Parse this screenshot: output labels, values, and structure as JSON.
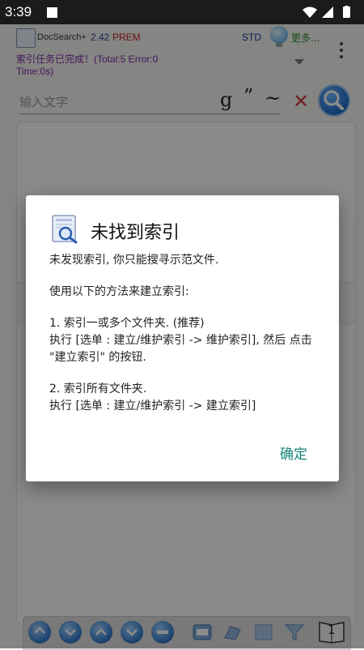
{
  "status_bar": {
    "time": "3:39"
  },
  "header": {
    "app_name": "DocSearch+",
    "version": "2.42",
    "edition": "PREM",
    "mode": "STD",
    "more": "更多..."
  },
  "index_status": {
    "line1": "索引任务已完成！(Total:5 Error:0",
    "line2": "Time:0s)"
  },
  "search": {
    "placeholder": "输入文字",
    "symbols": [
      "g",
      "”",
      "~"
    ]
  },
  "dialog": {
    "title": "未找到索引",
    "paragraphs": [
      "未发现索引, 你只能搜寻示范文件.",
      "使用以下的方法来建立索引:",
      "1. 索引一或多个文件夹. (推荐)",
      "执行 [选单 : 建立/维护索引 -> 维护索引], 然后 点击 \"建立索引\" 的按钮.",
      "2. 索引所有文件夹.",
      "执行 [选单 : 建立/维护索引 -> 建立索引]"
    ],
    "ok_label": "确定"
  },
  "bottom_bar": {
    "page_number": "1"
  },
  "colors": {
    "accent_teal": "#14857b",
    "status_purple": "#7a2aa8",
    "prem_red": "#c42020",
    "version_blue": "#2a3aa8"
  },
  "icons": {
    "wifi": "wifi-icon",
    "signal": "signal-icon",
    "battery": "battery-icon",
    "search": "magnifier-icon",
    "clear": "close-icon",
    "dialog": "document-search-icon"
  }
}
